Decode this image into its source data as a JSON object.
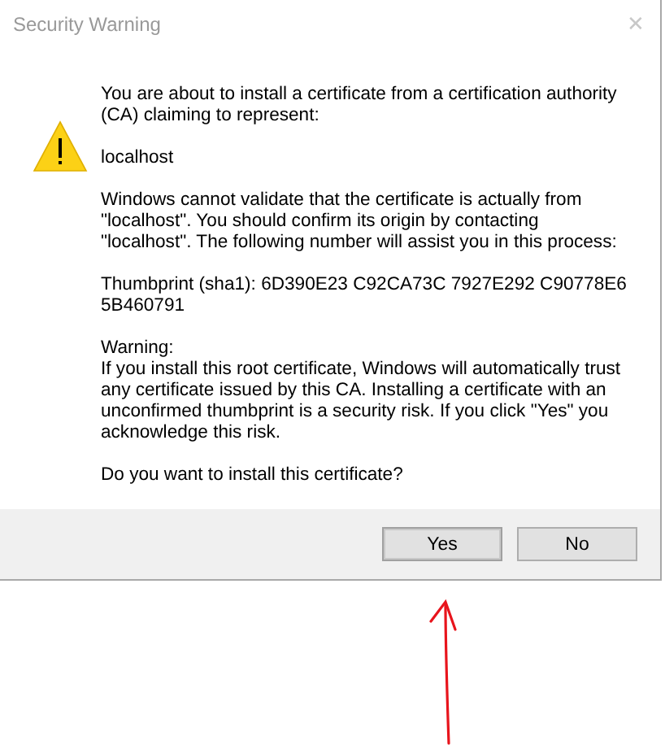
{
  "window": {
    "title": "Security Warning",
    "close_glyph": "✕"
  },
  "message": {
    "paragraphs": [
      "You are about to install a certificate from a certification authority (CA) claiming to represent:",
      "localhost",
      "Windows cannot validate that the certificate is actually from \"localhost\". You should confirm its origin by contacting \"localhost\". The following number will assist you in this process:",
      "Thumbprint (sha1): 6D390E23 C92CA73C 7927E292 C90778E6 5B460791",
      "Warning:\nIf you install this root certificate, Windows will automatically trust any certificate issued by this CA. Installing a certificate with an unconfirmed thumbprint is a security risk. If you click \"Yes\" you acknowledge this risk.",
      "Do you want to install this certificate?"
    ]
  },
  "buttons": [
    {
      "label": "Yes",
      "selected": true
    },
    {
      "label": "No",
      "selected": false
    }
  ]
}
